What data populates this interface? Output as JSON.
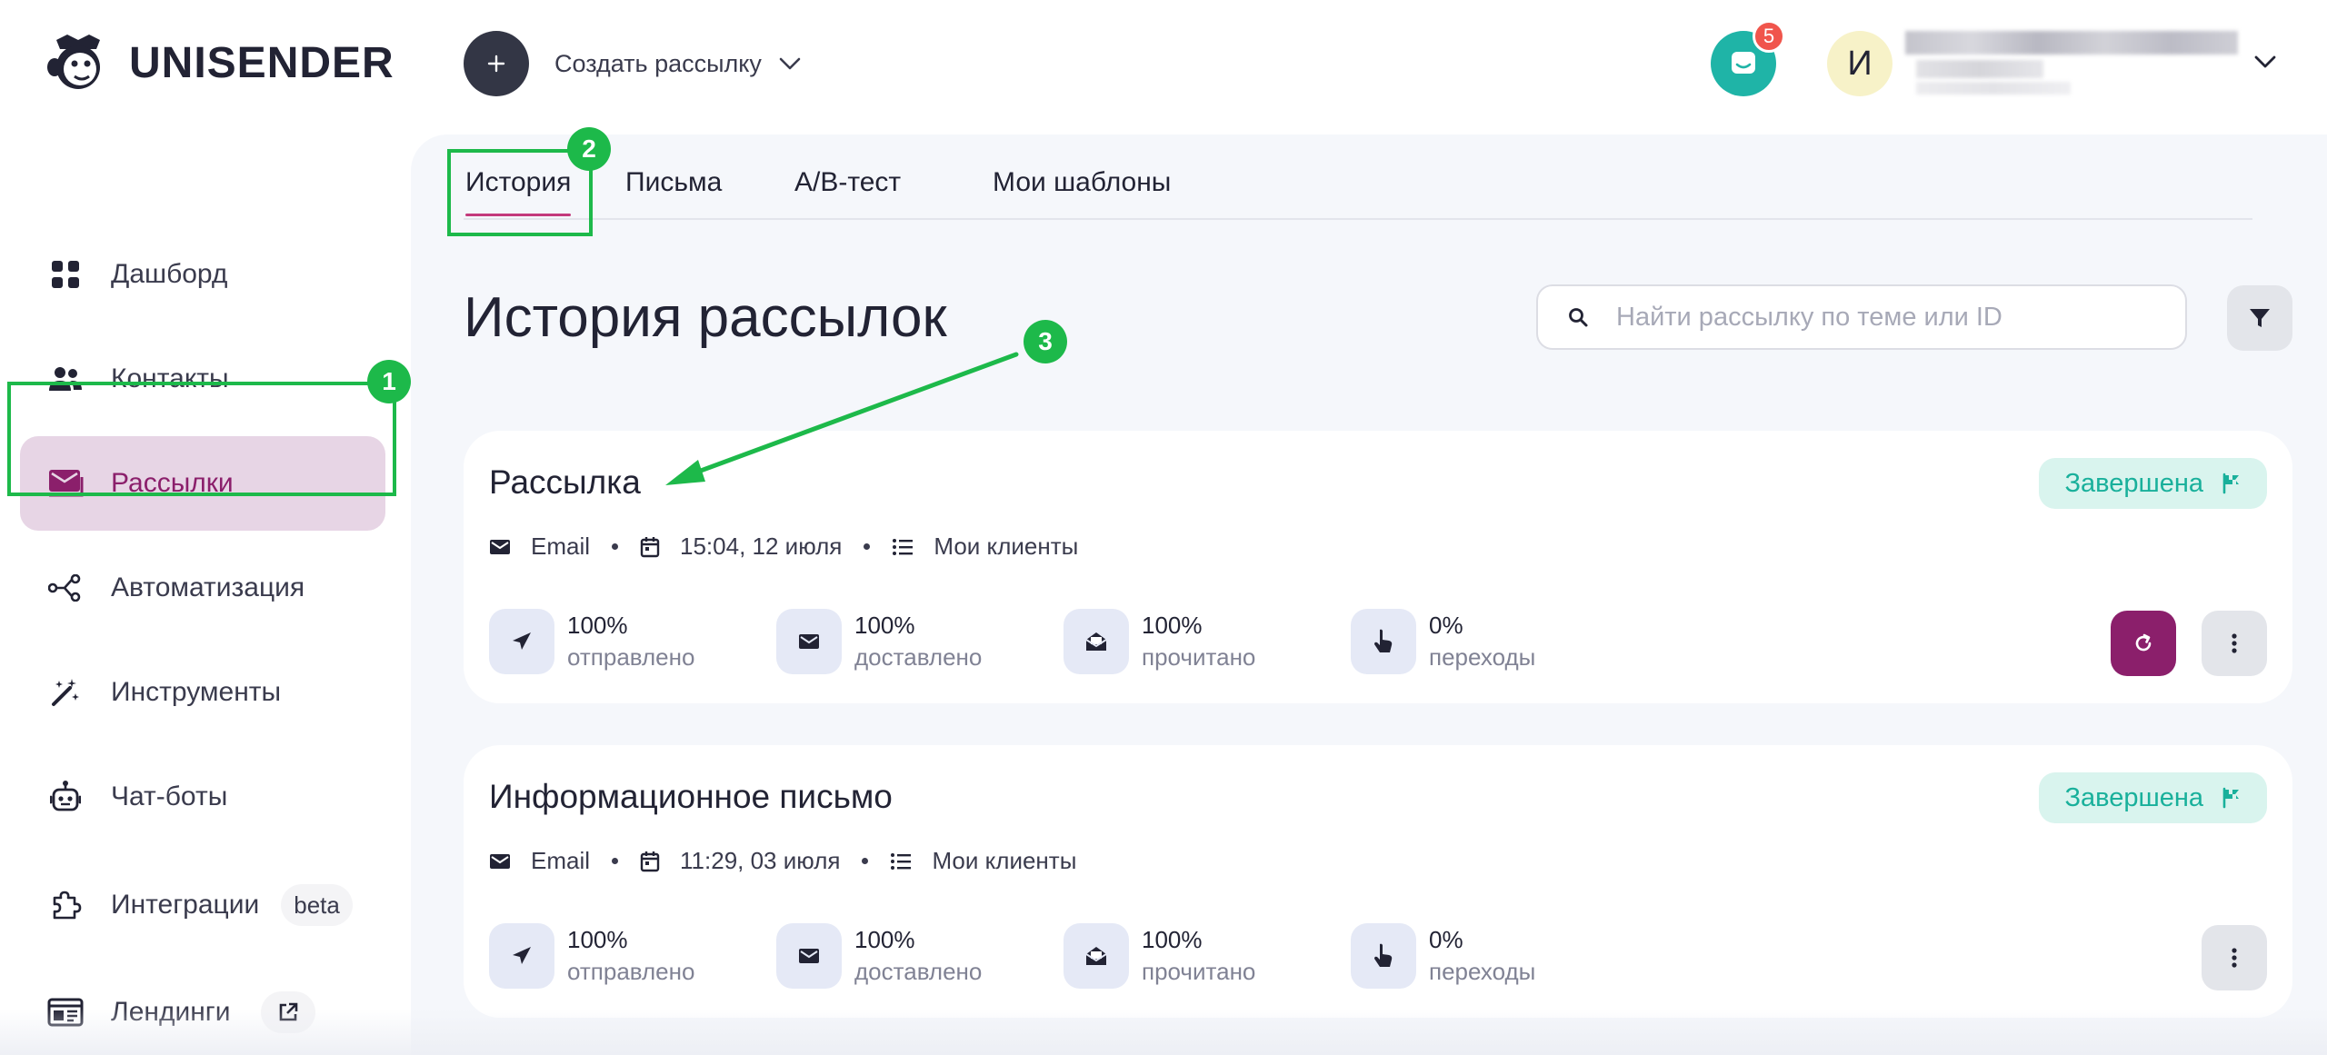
{
  "brand": {
    "name": "UNISENDER"
  },
  "topbar": {
    "create_label": "Создать рассылку",
    "notifications_count": "5",
    "avatar_initial": "И"
  },
  "sidebar": {
    "items": [
      {
        "label": "Дашборд",
        "icon": "dashboard-grid-icon"
      },
      {
        "label": "Контакты",
        "icon": "contacts-people-icon"
      },
      {
        "label": "Рассылки",
        "icon": "mailings-envelope-icon",
        "active": true
      },
      {
        "label": "Автоматизация",
        "icon": "automation-nodes-icon"
      },
      {
        "label": "Инструменты",
        "icon": "tools-magic-wand-icon"
      },
      {
        "label": "Чат-боты",
        "icon": "chatbot-robot-icon"
      },
      {
        "label": "Интеграции",
        "icon": "integrations-puzzle-icon",
        "pill": "beta"
      },
      {
        "label": "Лендинги",
        "icon": "landings-layout-icon",
        "external_icon": "external-link-icon"
      }
    ]
  },
  "tabs": [
    {
      "label": "История",
      "active": true
    },
    {
      "label": "Письма"
    },
    {
      "label": "A/B-тест"
    },
    {
      "label": "Мои шаблоны"
    }
  ],
  "page": {
    "title": "История рассылок",
    "search_placeholder": "Найти рассылку по теме или ID"
  },
  "campaigns": [
    {
      "title": "Рассылка",
      "status": "Завершена",
      "channel": "Email",
      "datetime": "15:04, 12 июля",
      "list": "Мои клиенты",
      "stats": [
        {
          "value": "100%",
          "label": "отправлено",
          "icon": "paper-plane-icon"
        },
        {
          "value": "100%",
          "label": "доставлено",
          "icon": "envelope-icon"
        },
        {
          "value": "100%",
          "label": "прочитано",
          "icon": "open-envelope-icon"
        },
        {
          "value": "0%",
          "label": "переходы",
          "icon": "pointer-hand-icon"
        }
      ],
      "has_repeat": true
    },
    {
      "title": "Информационное письмо",
      "status": "Завершена",
      "channel": "Email",
      "datetime": "11:29, 03 июля",
      "list": "Мои клиенты",
      "stats": [
        {
          "value": "100%",
          "label": "отправлено",
          "icon": "paper-plane-icon"
        },
        {
          "value": "100%",
          "label": "доставлено",
          "icon": "envelope-icon"
        },
        {
          "value": "100%",
          "label": "прочитано",
          "icon": "open-envelope-icon"
        },
        {
          "value": "0%",
          "label": "переходы",
          "icon": "pointer-hand-icon"
        }
      ],
      "has_repeat": false
    }
  ],
  "annotations": {
    "steps": [
      "1",
      "2",
      "3"
    ],
    "color": "#1db94a"
  },
  "colors": {
    "brand_accent": "#8b1f6b",
    "active_nav_bg": "#e7d5e5",
    "status_green": "#19b09b",
    "chat_teal": "#1fb4a7",
    "badge_red": "#f0554c"
  }
}
